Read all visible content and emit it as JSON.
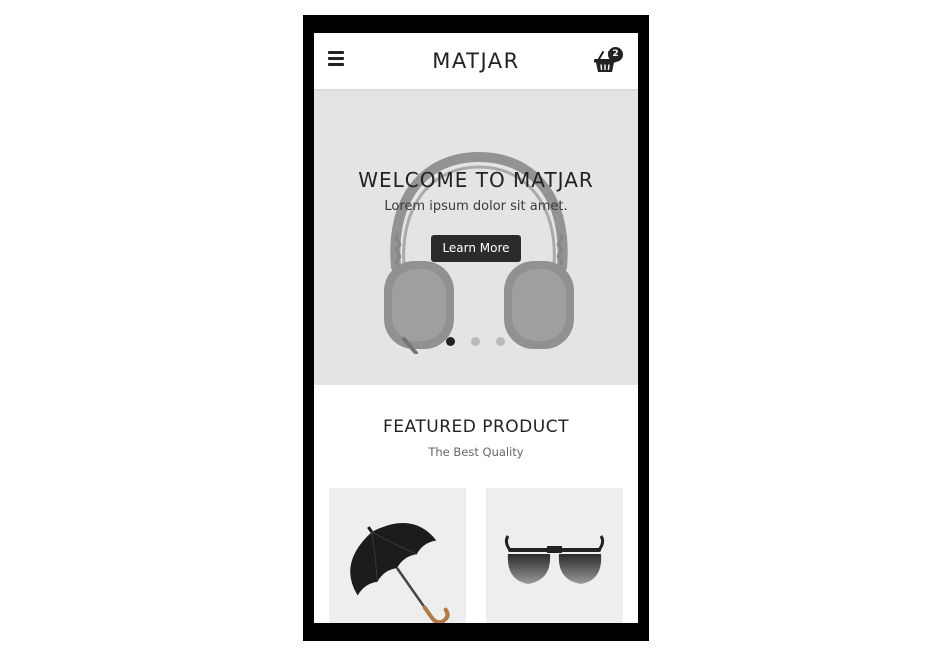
{
  "header": {
    "brand": "MATJAR",
    "menu_icon": "hamburger-menu-icon",
    "cart_icon": "shopping-basket-icon",
    "cart_count": "2"
  },
  "hero": {
    "title": "WELCOME TO MATJAR",
    "subtitle": "Lorem ipsum dolor sit amet.",
    "cta_label": "Learn More",
    "image": "headphones",
    "slides": 3,
    "active_slide": 1
  },
  "featured": {
    "title": "FEATURED PRODUCT",
    "subtitle": "The Best Quality",
    "products": [
      {
        "image": "umbrella"
      },
      {
        "image": "sunglasses"
      }
    ]
  },
  "colors": {
    "hero_bg": "#e4e4e4",
    "dark": "#222222",
    "card_bg": "#eeeeee",
    "frame": "#000000"
  }
}
